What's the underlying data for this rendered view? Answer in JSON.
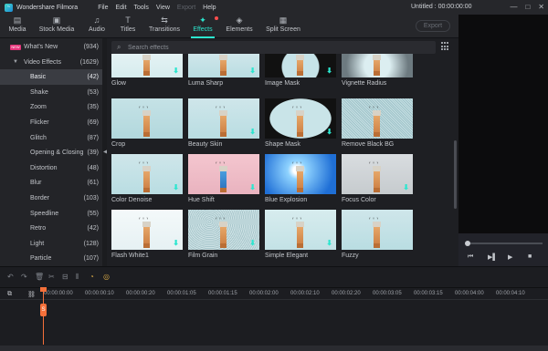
{
  "app": {
    "name": "Wondershare Filmora",
    "doc_title": "Untitled : 00:00:00:00",
    "logo_glyph": "~"
  },
  "menu": [
    {
      "label": "File"
    },
    {
      "label": "Edit"
    },
    {
      "label": "Tools"
    },
    {
      "label": "View"
    },
    {
      "label": "Export"
    },
    {
      "label": "Help"
    }
  ],
  "window_controls": {
    "minimize": "—",
    "maximize": "□",
    "close": "✕"
  },
  "toolbar": {
    "tabs": [
      {
        "label": "Media",
        "icon": "folder-icon",
        "glyph": "▤"
      },
      {
        "label": "Stock Media",
        "icon": "stock-media-icon",
        "glyph": "▣"
      },
      {
        "label": "Audio",
        "icon": "music-note-icon",
        "glyph": "♫"
      },
      {
        "label": "Titles",
        "icon": "titles-icon",
        "glyph": "T"
      },
      {
        "label": "Transitions",
        "icon": "transitions-icon",
        "glyph": "⇆"
      },
      {
        "label": "Effects",
        "icon": "effects-icon",
        "glyph": "✦"
      },
      {
        "label": "Elements",
        "icon": "elements-icon",
        "glyph": "◈"
      },
      {
        "label": "Split Screen",
        "icon": "split-screen-icon",
        "glyph": "▦"
      }
    ],
    "export_label": "Export"
  },
  "sidebar": {
    "items": [
      {
        "label": "What's New",
        "count": "(934)",
        "badge": "NEW"
      },
      {
        "label": "Video Effects",
        "count": "(1629)",
        "caret": "▼"
      },
      {
        "label": "Basic",
        "count": "(42)"
      },
      {
        "label": "Shake",
        "count": "(53)"
      },
      {
        "label": "Zoom",
        "count": "(35)"
      },
      {
        "label": "Flicker",
        "count": "(69)"
      },
      {
        "label": "Glitch",
        "count": "(87)"
      },
      {
        "label": "Opening & Closing",
        "count": "(39)"
      },
      {
        "label": "Distortion",
        "count": "(48)"
      },
      {
        "label": "Blur",
        "count": "(61)"
      },
      {
        "label": "Border",
        "count": "(103)"
      },
      {
        "label": "Speedline",
        "count": "(55)"
      },
      {
        "label": "Retro",
        "count": "(42)"
      },
      {
        "label": "Light",
        "count": "(128)"
      },
      {
        "label": "Particle",
        "count": "(107)"
      }
    ],
    "selected_index": 2,
    "collapse_glyph": "◀"
  },
  "search": {
    "placeholder": "Search effects",
    "icon_glyph": "⌕"
  },
  "effects": [
    {
      "name": "Glow",
      "style": "glow",
      "download": true
    },
    {
      "name": "Luma Sharp",
      "style": "plain",
      "download": true
    },
    {
      "name": "Image Mask",
      "style": "mask",
      "download": true
    },
    {
      "name": "Vignette Radius",
      "style": "vignette",
      "download": false
    },
    {
      "name": "Crop",
      "style": "crop",
      "download": false
    },
    {
      "name": "Beauty Skin",
      "style": "plain",
      "download": true
    },
    {
      "name": "Shape Mask",
      "style": "shape",
      "download": true
    },
    {
      "name": "Remove Black BG",
      "style": "noise",
      "download": false
    },
    {
      "name": "Color Denoise",
      "style": "plain",
      "download": true
    },
    {
      "name": "Hue Shift",
      "style": "hue",
      "download": true
    },
    {
      "name": "Blue Explosion",
      "style": "blue",
      "download": false
    },
    {
      "name": "Focus Color",
      "style": "focus",
      "download": true
    },
    {
      "name": "Flash White1",
      "style": "flash",
      "download": true
    },
    {
      "name": "Film Grain",
      "style": "grain",
      "download": true
    },
    {
      "name": "Simple Elegant",
      "style": "elegant",
      "download": true
    },
    {
      "name": "Fuzzy",
      "style": "plain",
      "download": false
    }
  ],
  "download_glyph": "⬇",
  "birds_glyph": "ᵥ ᵥ ᵥ",
  "preview": {
    "controls": [
      "⏮",
      "▶▌",
      "▶",
      "■"
    ]
  },
  "timeline": {
    "tools": [
      "↶",
      "↷",
      "🗑",
      "✂",
      "⊟",
      "⫴",
      "◔",
      "◎"
    ],
    "add_track_icon": "⧉",
    "link_icon": "⛓",
    "playhead_glyph": "S",
    "ticks": [
      "00:00:00:00",
      "00:00:00:10",
      "00:00:00:20",
      "00:00:01:05",
      "00:00:01:15",
      "00:00:02:00",
      "00:00:02:10",
      "00:00:02:20",
      "00:00:03:05",
      "00:00:03:15",
      "00:00:04:00",
      "00:00:04:10"
    ]
  },
  "colors": {
    "accent": "#2ce6cf",
    "playhead": "#f5703a",
    "new_badge": "#e6337a"
  }
}
